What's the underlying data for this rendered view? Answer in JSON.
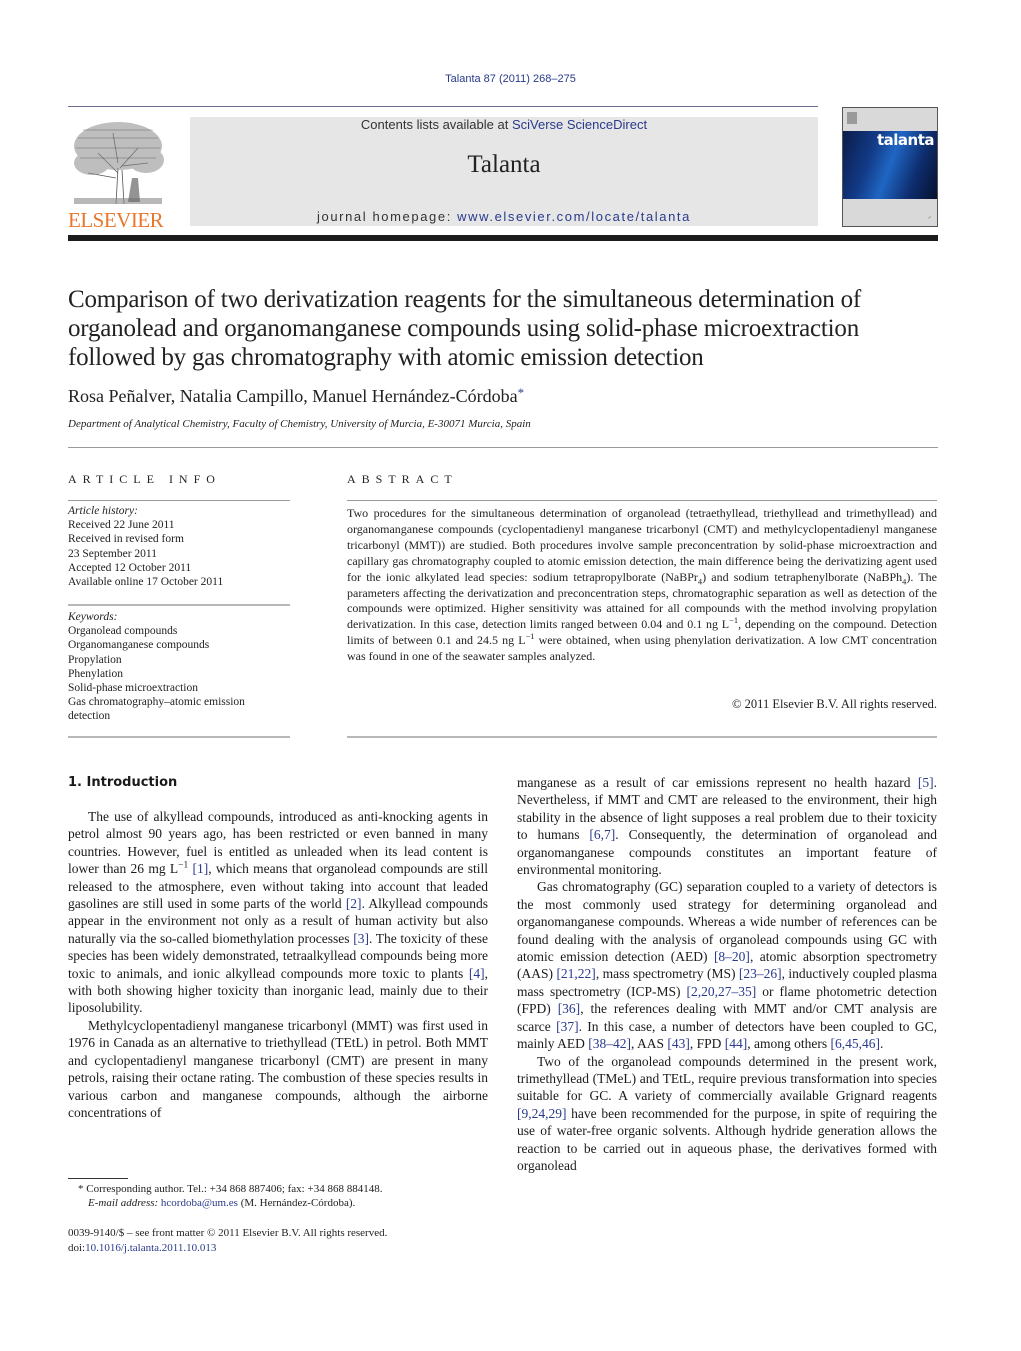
{
  "header": {
    "citation": "Talanta 87 (2011) 268–275",
    "contents_prefix": "Contents lists available at ",
    "contents_link": "SciVerse ScienceDirect",
    "journal_name": "Talanta",
    "homepage_prefix": "journal homepage: ",
    "homepage_link": "www.elsevier.com/locate/talanta",
    "publisher_logo_text": "ELSEVIER",
    "cover_title": "talanta",
    "colors": {
      "link": "#2a3a8c",
      "publisher_orange": "#e8772e",
      "band": "#e6e6e6"
    }
  },
  "article": {
    "title": "Comparison of two derivatization reagents for the simultaneous determination of organolead and organomanganese compounds using solid-phase microextraction followed by gas chromatography with atomic emission detection",
    "authors": "Rosa Peñalver, Natalia Campillo, Manuel Hernández-Córdoba",
    "corresponding_mark": "*",
    "affiliation": "Department of Analytical Chemistry, Faculty of Chemistry, University of Murcia, E-30071 Murcia, Spain"
  },
  "article_info": {
    "heading": "ARTICLE INFO",
    "history_label": "Article history:",
    "history": [
      "Received 22 June 2011",
      "Received in revised form",
      "23 September 2011",
      "Accepted 12 October 2011",
      "Available online 17 October 2011"
    ],
    "keywords_label": "Keywords:",
    "keywords": [
      "Organolead compounds",
      "Organomanganese compounds",
      "Propylation",
      "Phenylation",
      "Solid-phase microextraction",
      "Gas chromatography–atomic emission",
      "detection"
    ]
  },
  "abstract": {
    "heading": "ABSTRACT",
    "p1": "Two procedures for the simultaneous determination of organolead (tetraethyllead, triethyllead and trimethyllead) and organomanganese compounds (cyclopentadienyl manganese tricarbonyl (CMT) and methylcyclopentadienyl manganese tricarbonyl (MMT)) are studied. Both procedures involve sample preconcentration by solid-phase microextraction and capillary gas chromatography coupled to atomic emission detection, the main difference being the derivatizing agent used for the ionic alkylated lead species: sodium tetrapropylborate (NaBPr",
    "sub1": "4",
    "p2": ") and sodium tetraphenylborate (NaBPh",
    "sub2": "4",
    "p3": "). The parameters affecting the derivatization and preconcentration steps, chromatographic separation as well as detection of the compounds were optimized. Higher sensitivity was attained for all compounds with the method involving propylation derivatization. In this case, detection limits ranged between 0.04 and 0.1 ng L",
    "sup1": "−1",
    "p4": ", depending on the compound. Detection limits of between 0.1 and 24.5 ng L",
    "sup2": "−1",
    "p5": " were obtained, when using phenylation derivatization. A low CMT concentration was found in one of the seawater samples analyzed.",
    "copyright": "© 2011 Elsevier B.V. All rights reserved."
  },
  "introduction": {
    "heading": "1.  Introduction",
    "left": {
      "para1": {
        "t1": "The use of alkyllead compounds, introduced as anti-knocking agents in petrol almost 90 years ago, has been restricted or even banned in many countries. However, fuel is entitled as unleaded when its lead content is lower than 26 mg L",
        "sup": "−1",
        "r1": "[1]",
        "t2": ", which means that organolead compounds are still released to the atmosphere, even without taking into account that leaded gasolines are still used in some parts of the world ",
        "r2": "[2]",
        "t3": ". Alkyllead compounds appear in the environment not only as a result of human activity but also naturally via the so-called biomethylation processes ",
        "r3": "[3]",
        "t4": ". The toxicity of these species has been widely demonstrated, tetraalkyllead compounds being more toxic to animals, and ionic alkyllead compounds more toxic to plants ",
        "r4": "[4]",
        "t5": ", with both showing higher toxicity than inorganic lead, mainly due to their liposolubility."
      },
      "para2": "Methylcyclopentadienyl manganese tricarbonyl (MMT) was first used in 1976 in Canada as an alternative to triethyllead (TEtL) in petrol. Both MMT and cyclopentadienyl manganese tricarbonyl (CMT) are present in many petrols, raising their octane rating. The combustion of these species results in various carbon and manganese compounds, although the airborne concentrations of"
    },
    "right": {
      "para1": {
        "t1": "manganese as a result of car emissions represent no health hazard ",
        "r1": "[5]",
        "t2": ". Nevertheless, if MMT and CMT are released to the environment, their high stability in the absence of light supposes a real problem due to their toxicity to humans ",
        "r2": "[6,7]",
        "t3": ". Consequently, the determination of organolead and organomanganese compounds constitutes an important feature of environmental monitoring."
      },
      "para2": {
        "t1": "Gas chromatography (GC) separation coupled to a variety of detectors is the most commonly used strategy for determining organolead and organomanganese compounds. Whereas a wide number of references can be found dealing with the analysis of organolead compounds using GC with atomic emission detection (AED) ",
        "r1": "[8–20]",
        "t2": ", atomic absorption spectrometry (AAS) ",
        "r2": "[21,22]",
        "t3": ", mass spectrometry (MS) ",
        "r3": "[23–26]",
        "t4": ", inductively coupled plasma mass spectrometry (ICP-MS) ",
        "r4": "[2,20,27–35]",
        "t5": " or flame photometric detection (FPD) ",
        "r5": "[36]",
        "t6": ", the references dealing with MMT and/or CMT analysis are scarce ",
        "r6": "[37]",
        "t7": ". In this case, a number of detectors have been coupled to GC, mainly AED ",
        "r7": "[38–42]",
        "t8": ", AAS ",
        "r8": "[43]",
        "t9": ", FPD ",
        "r9": "[44]",
        "t10": ", among others ",
        "r10": "[6,45,46]",
        "t11": "."
      },
      "para3": {
        "t1": "Two of the organolead compounds determined in the present work, trimethyllead (TMeL) and TEtL, require previous transformation into species suitable for GC. A variety of commercially available Grignard reagents ",
        "r1": "[9,24,29]",
        "t2": " have been recommended for the purpose, in spite of requiring the use of water-free organic solvents. Although hydride generation allows the reaction to be carried out in aqueous phase, the derivatives formed with organolead"
      }
    }
  },
  "footnote": {
    "mark": "*",
    "text": "Corresponding author. Tel.: +34 868 887406; fax: +34 868 884148.",
    "email_label": "E-mail address:",
    "email": "hcordoba@um.es",
    "email_suffix": " (M. Hernández-Córdoba)."
  },
  "front_matter": {
    "issn_line": "0039-9140/$ – see front matter © 2011 Elsevier B.V. All rights reserved.",
    "doi_prefix": "doi:",
    "doi": "10.1016/j.talanta.2011.10.013"
  }
}
